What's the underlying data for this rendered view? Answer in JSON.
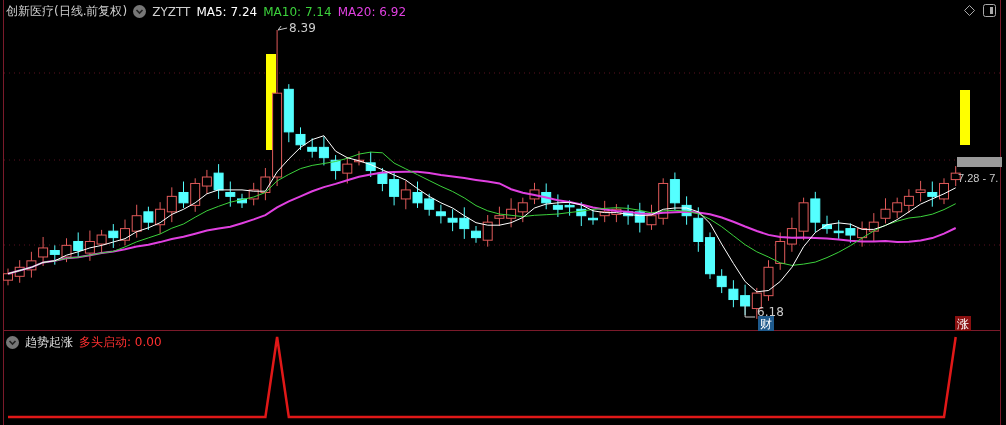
{
  "header": {
    "title": "创新医疗(日线.前复权)",
    "indicator": "ZYZTT",
    "ma": [
      {
        "label": "MA5: 7.24",
        "color": "#ffffff"
      },
      {
        "label": "MA10: 7.14",
        "color": "#3cd23c"
      },
      {
        "label": "MA20: 6.92",
        "color": "#e040e0"
      }
    ]
  },
  "price_labels": {
    "high": "8.39",
    "low": "6.18",
    "current": "7.28 - 7."
  },
  "markers": [
    {
      "text": "财",
      "kind": "finance"
    },
    {
      "text": "涨",
      "kind": "rise"
    }
  ],
  "sub_panel": {
    "title": "趋势起涨",
    "reading": "多头启动: 0.00"
  }
}
